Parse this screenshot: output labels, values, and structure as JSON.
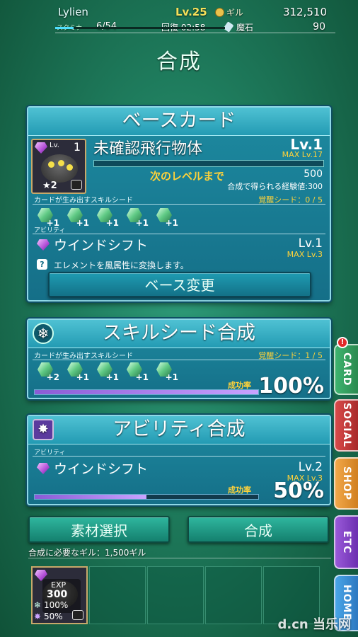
{
  "status": {
    "player_name": "Lylien",
    "level": "Lv.25",
    "gil_label": "ギル",
    "gil_value": "312,510",
    "stamina_label": "スタミナ",
    "stamina_value": "6/54",
    "recover_text": "回復 02:58",
    "stone_label": "魔石",
    "stone_value": "90",
    "stamina_fraction": 0.11
  },
  "page_title": "合成",
  "base_card": {
    "header": "ベースカード",
    "card_name": "未確認飛行物体",
    "card_level_small": "Lv.",
    "card_level_num": "1",
    "card_star": "★2",
    "level": "Lv.1",
    "max_level": "MAX Lv.17",
    "next_level_label": "次のレベルまで",
    "next_level_value": "500",
    "exp_gain": "合成で得られる経験値:300",
    "seed_label": "カードが生み出すスキルシード",
    "awaken_seed": "覚醒シード：0 / 5",
    "seeds": [
      "+1",
      "+1",
      "+1",
      "+1",
      "+1"
    ],
    "ability_label": "アビリティ",
    "ability_name": "ウインドシフト",
    "ability_level": "Lv.1",
    "ability_max": "MAX Lv.3",
    "ability_desc": "エレメントを風属性に変換します。",
    "change_button": "ベース変更"
  },
  "skill_seed": {
    "header": "スキルシード合成",
    "seed_label": "カードが生み出すスキルシード",
    "awaken_seed": "覚醒シード：1 / 5",
    "seeds": [
      "+2",
      "+1",
      "+1",
      "+1",
      "+1"
    ],
    "rate_label": "成功率",
    "rate_value": "100%",
    "rate_fraction": 1.0
  },
  "ability_synth": {
    "header": "アビリティ合成",
    "ability_label": "アビリティ",
    "ability_name": "ウインドシフト",
    "ability_level": "Lv.2",
    "ability_max": "MAX Lv.3",
    "rate_label": "成功率",
    "rate_value": "50%",
    "rate_fraction": 0.5
  },
  "buttons": {
    "material_select": "素材選択",
    "synthesize": "合成"
  },
  "required_gil": "合成に必要なギル：1,500ギル",
  "material": {
    "exp_label": "EXP",
    "exp_value": "300",
    "seed_pct": "100%",
    "ability_pct": "50%"
  },
  "side_tabs": [
    "CARD",
    "SOCIAL",
    "SHOP",
    "ETC",
    "HOME"
  ],
  "watermark": "d.cn 当乐网"
}
